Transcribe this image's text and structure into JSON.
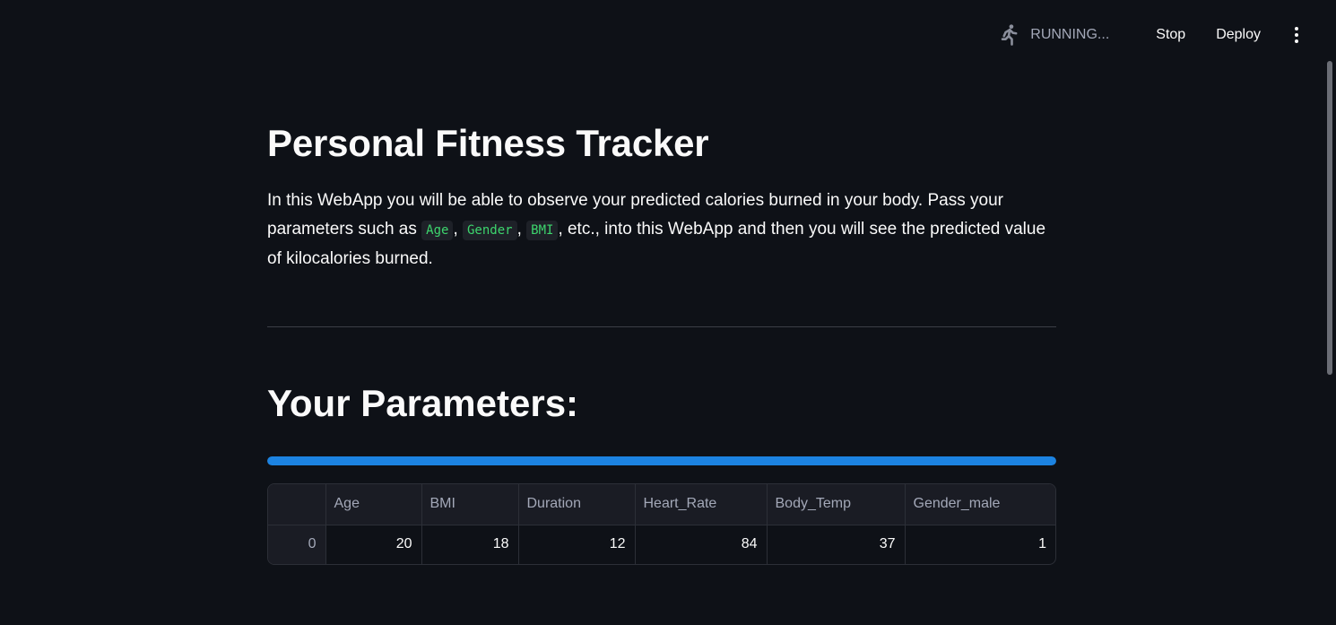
{
  "toolbar": {
    "status_text": "RUNNING...",
    "stop_label": "Stop",
    "deploy_label": "Deploy"
  },
  "page": {
    "title": "Personal Fitness Tracker",
    "intro": {
      "part1": "In this WebApp you will be able to observe your predicted calories burned in your body. Pass your parameters such as ",
      "code1": "Age",
      "sep1": ", ",
      "code2": "Gender",
      "sep2": ", ",
      "code3": "BMI",
      "part2": ", etc., into this WebApp and then you will see the predicted value of kilocalories burned."
    },
    "section_title": "Your Parameters:"
  },
  "progress": {
    "value_percent": 100,
    "color": "#1c83e1"
  },
  "table": {
    "columns": [
      "",
      "Age",
      "BMI",
      "Duration",
      "Heart_Rate",
      "Body_Temp",
      "Gender_male"
    ],
    "rows": [
      [
        "0",
        "20",
        "18",
        "12",
        "84",
        "37",
        "1"
      ]
    ]
  },
  "colors": {
    "background": "#0e1117",
    "code_text": "#3dd56d"
  }
}
